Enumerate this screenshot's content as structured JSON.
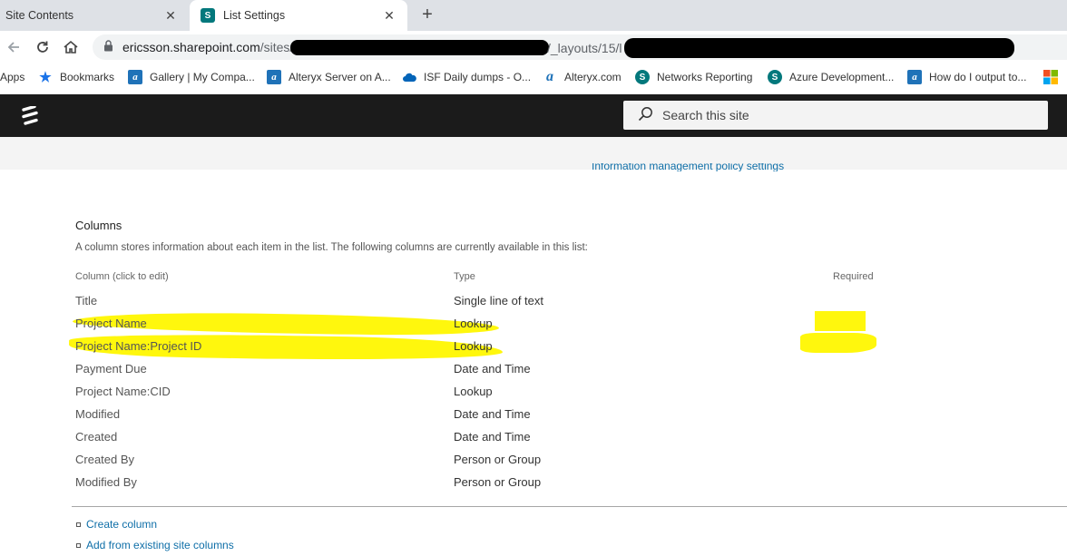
{
  "tabs": [
    {
      "title": "Site Contents"
    },
    {
      "title": "List Settings",
      "favicon": "S"
    }
  ],
  "toolbar": {
    "url_host": "ericsson.sharepoint.com",
    "url_path_1": "/sites/",
    "url_path_2": "/_layouts/15/l"
  },
  "bookmarks": [
    {
      "label": "Apps",
      "icon": "apps-grid-icon"
    },
    {
      "label": "Bookmarks",
      "icon": "star-icon"
    },
    {
      "label": "Gallery | My Compa...",
      "icon": "alteryx-gallery-icon"
    },
    {
      "label": "Alteryx Server on A...",
      "icon": "alteryx-gallery-icon"
    },
    {
      "label": "ISF Daily dumps - O...",
      "icon": "onedrive-cloud-icon"
    },
    {
      "label": "Alteryx.com",
      "icon": "alteryx-icon"
    },
    {
      "label": "Networks Reporting",
      "icon": "sharepoint-icon"
    },
    {
      "label": "Azure Development...",
      "icon": "sharepoint-icon"
    },
    {
      "label": "How do I output to...",
      "icon": "alteryx-gallery-icon"
    }
  ],
  "header": {
    "search_placeholder": "Search this site"
  },
  "clipped_link": "Information management policy settings",
  "columns_section": {
    "title": "Columns",
    "description": "A column stores information about each item in the list. The following columns are currently available in this list:",
    "headers": {
      "column": "Column (click to edit)",
      "type": "Type",
      "required": "Required"
    },
    "rows": [
      {
        "name": "Title",
        "type": "Single line of text"
      },
      {
        "name": "Project Name",
        "type": "Lookup"
      },
      {
        "name": "Project Name:Project ID",
        "type": "Lookup"
      },
      {
        "name": "Payment Due",
        "type": "Date and Time"
      },
      {
        "name": "Project Name:CID",
        "type": "Lookup"
      },
      {
        "name": "Modified",
        "type": "Date and Time"
      },
      {
        "name": "Created",
        "type": "Date and Time"
      },
      {
        "name": "Created By",
        "type": "Person or Group"
      },
      {
        "name": "Modified By",
        "type": "Person or Group"
      }
    ]
  },
  "actions": {
    "create_column": "Create column",
    "add_existing": "Add from existing site columns"
  },
  "colors": {
    "header_bg": "#1b1b1b",
    "link": "#0f6fa8",
    "highlight": "#fff700",
    "sharepoint_teal": "#03787c"
  }
}
